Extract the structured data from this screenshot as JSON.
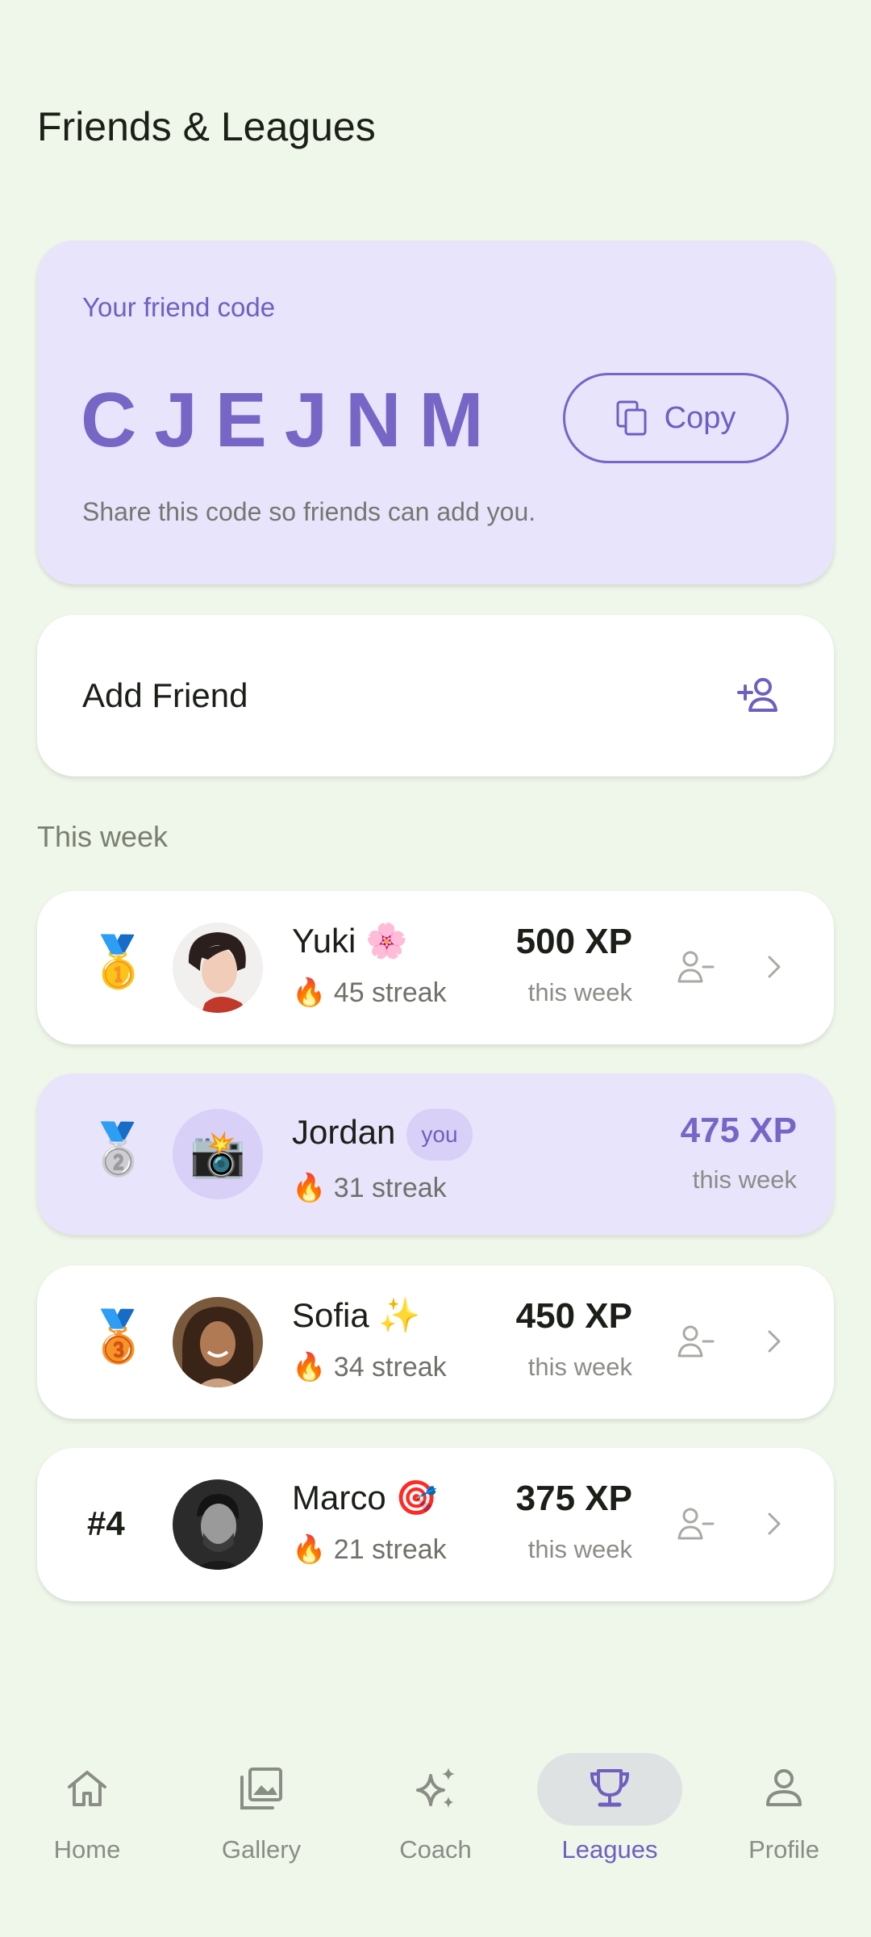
{
  "header": {
    "title": "Friends & Leagues"
  },
  "friend_code": {
    "label": "Your friend code",
    "code": "CJEJNM",
    "copy_label": "Copy",
    "hint": "Share this code so friends can add you."
  },
  "add_friend": {
    "label": "Add Friend",
    "icon": "person-add-icon"
  },
  "section": {
    "label": "This week"
  },
  "leaderboard": [
    {
      "rank": "🥇",
      "name": "Yuki 🌸",
      "streak": "🔥 45 streak",
      "xp": "500 XP",
      "xp_sub": "this week"
    },
    {
      "rank": "🥈",
      "name": "Jordan",
      "you": "you",
      "avatar_emoji": "📸",
      "streak": "🔥 31 streak",
      "xp": "475 XP",
      "xp_sub": "this week"
    },
    {
      "rank": "🥉",
      "name": "Sofia ✨",
      "streak": "🔥 34 streak",
      "xp": "450 XP",
      "xp_sub": "this week"
    },
    {
      "rank": "#4",
      "name": "Marco 🎯",
      "streak": "🔥 21 streak",
      "xp": "375 XP",
      "xp_sub": "this week"
    }
  ],
  "nav": [
    {
      "label": "Home",
      "icon": "home-icon"
    },
    {
      "label": "Gallery",
      "icon": "gallery-icon"
    },
    {
      "label": "Coach",
      "icon": "sparkle-icon"
    },
    {
      "label": "Leagues",
      "icon": "trophy-icon",
      "active": true
    },
    {
      "label": "Profile",
      "icon": "person-icon"
    }
  ],
  "colors": {
    "background": "#eff6ea",
    "accent": "#7766c6",
    "code_card": "#e8e4fc",
    "card": "#ffffff"
  }
}
